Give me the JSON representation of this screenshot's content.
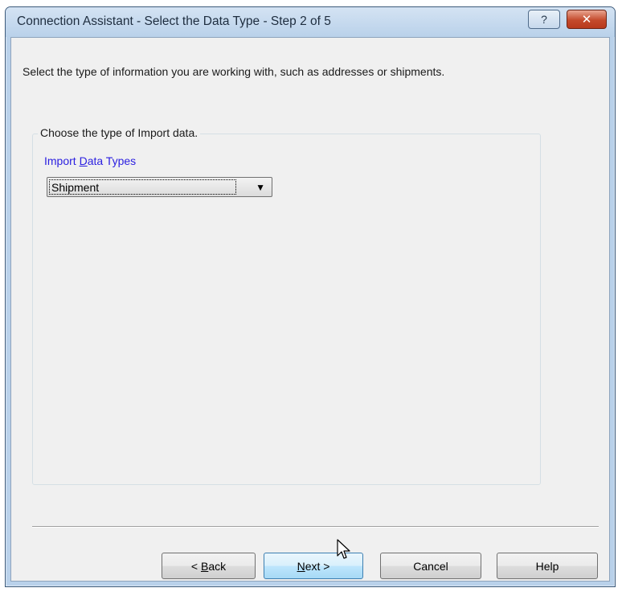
{
  "window": {
    "title": "Connection Assistant - Select the Data Type - Step 2 of 5",
    "help_glyph": "?",
    "close_glyph": "✕"
  },
  "instruction": "Select the type of information you are working with, such as addresses or shipments.",
  "group": {
    "legend": "Choose the type of Import data.",
    "field_label_pre": "Import ",
    "field_label_underline": "D",
    "field_label_post": "ata Types",
    "combo_value": "Shipment",
    "combo_arrow": "▼"
  },
  "buttons": {
    "back_pre": "< ",
    "back_underline": "B",
    "back_post": "ack",
    "next_underline": "N",
    "next_post": "ext >",
    "cancel": "Cancel",
    "help": "Help"
  },
  "colors": {
    "field_label": "#2a1ee0",
    "close_button": "#c44a2c",
    "title_bar": "#b9d1ea",
    "client_area": "#f0f0f0"
  }
}
